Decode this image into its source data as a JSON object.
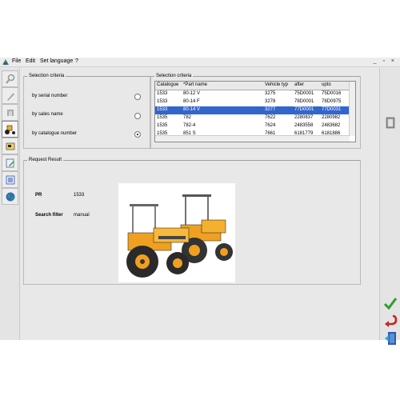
{
  "menu": {
    "items": [
      "File",
      "Edit",
      "Set language",
      "?"
    ],
    "window_buttons": "_ ▫ ×"
  },
  "left_tools": [
    {
      "icon": "search-icon"
    },
    {
      "icon": "wrench-icon"
    },
    {
      "icon": "gear-icon"
    },
    {
      "icon": "tractor-icon"
    },
    {
      "icon": "card-icon"
    },
    {
      "icon": "edit-icon"
    },
    {
      "icon": "list-icon"
    },
    {
      "icon": "globe-icon"
    }
  ],
  "selection_criteria_left": {
    "legend": "Selection criteria",
    "options": [
      {
        "label": "by serial number",
        "selected": false
      },
      {
        "label": "by sales name",
        "selected": false
      },
      {
        "label": "by catalogue number",
        "selected": true
      }
    ]
  },
  "selection_criteria_right": {
    "legend": "Selection criteria",
    "columns": [
      "Catalogue",
      "*Part name",
      "Vehicle typ",
      "after",
      "upto"
    ],
    "rows": [
      [
        "1533",
        "80-12 V",
        "3275",
        "75D0001",
        "75D0016"
      ],
      [
        "1533",
        "80-14 F",
        "3278",
        "78D0001",
        "78D0975"
      ],
      [
        "1533",
        "80-14 V",
        "3277",
        "77D0001",
        "77D0031"
      ],
      [
        "1535",
        "782",
        "7622",
        "2280837",
        "2280982"
      ],
      [
        "1535",
        "782-4",
        "7624",
        "2483558",
        "2483682"
      ],
      [
        "1535",
        "851 S",
        "7661",
        "6181779",
        "6181886"
      ]
    ],
    "selected_row": 2
  },
  "request_result": {
    "legend": "Request Result",
    "pr_label": "PR",
    "pr_value": "1533",
    "filter_label": "Search filter",
    "filter_value": "manual"
  },
  "colors": {
    "selection": "#3366cc",
    "tractor_body": "#f0a020",
    "ok_green": "#2e9e2e",
    "back_red": "#cc2222"
  }
}
